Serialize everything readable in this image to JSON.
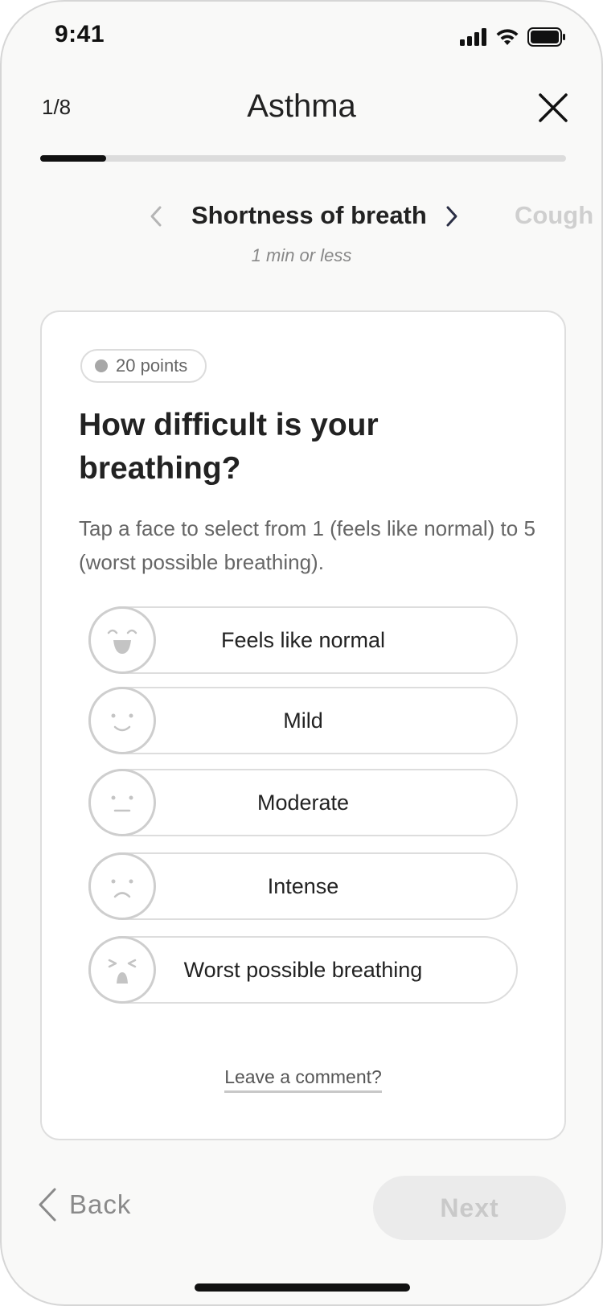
{
  "status_bar": {
    "time": "9:41",
    "icons": [
      "cellular-signal-icon",
      "wifi-icon",
      "battery-icon"
    ]
  },
  "header": {
    "step_counter": "1/8",
    "title": "Asthma",
    "close_icon": "close-icon",
    "progress": {
      "current": 1,
      "total": 8
    }
  },
  "carousel": {
    "current": "Shortness of breath",
    "next": "Cough",
    "duration": "1 min or less"
  },
  "card": {
    "points_badge": "20 points",
    "question": "How difficult is your breathing?",
    "instructions": "Tap a face to select from 1 (feels like normal) to 5 (worst possible breathing).",
    "options": [
      {
        "label": "Feels like normal",
        "icon": "laughing-face-icon"
      },
      {
        "label": "Mild",
        "icon": "smiling-face-icon"
      },
      {
        "label": "Moderate",
        "icon": "neutral-face-icon"
      },
      {
        "label": "Intense",
        "icon": "frowning-face-icon"
      },
      {
        "label": "Worst possible breathing",
        "icon": "distressed-face-icon"
      }
    ],
    "comment_link": "Leave a comment?"
  },
  "footer": {
    "back_label": "Back",
    "next_label": "Next"
  },
  "colors": {
    "text_primary": "#222222",
    "text_secondary": "#666666",
    "disabled": "#c9c9c9",
    "progress_fill": "#111111",
    "progress_track": "#dcdcdc"
  }
}
